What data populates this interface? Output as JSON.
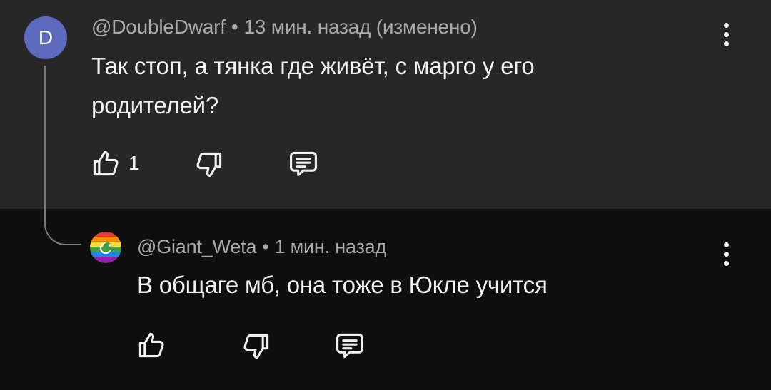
{
  "comment": {
    "avatar_letter": "D",
    "avatar_color": "#5c6bc0",
    "author": "@DoubleDwarf",
    "separator": "•",
    "time": "13 мин. назад (изменено)",
    "text_line1": "Так стоп, а тянка где живёт, с марго у его",
    "text_line2": "родителей?",
    "like_count": "1",
    "icons": [
      "thumb-up-icon",
      "thumb-down-icon",
      "reply-comment-icon",
      "more-vert-icon"
    ]
  },
  "reply": {
    "author": "@Giant_Weta",
    "separator": "•",
    "time": "1 мин. назад",
    "text": "В общаге мб, она тоже в Юкле учится",
    "avatar_colors": [
      "#e53935",
      "#fb8c00",
      "#fdd835",
      "#43a047",
      "#1e88e5",
      "#8e24aa"
    ],
    "icons": [
      "thumb-up-icon",
      "thumb-down-icon",
      "reply-comment-icon",
      "more-vert-icon"
    ]
  },
  "colors": {
    "top_background": "#272727",
    "bottom_background": "#0f0f0f",
    "text": "#f1f1f1",
    "meta": "#aaaaaa"
  }
}
